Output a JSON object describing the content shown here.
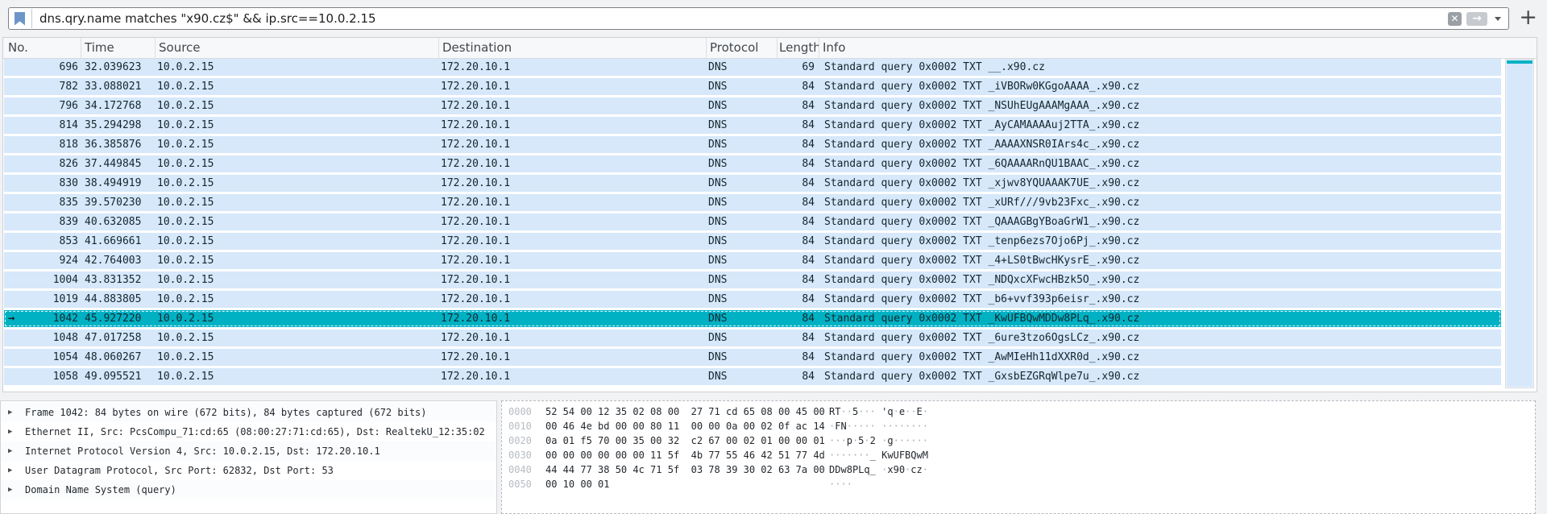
{
  "filter": {
    "expression": "dns.qry.name matches \"x90.cz$\" && ip.src==10.0.2.15",
    "add_button": "+"
  },
  "icons": {
    "clear": "✕",
    "apply": "→"
  },
  "colors": {
    "selected_row_bg": "#00b1c4",
    "row_bg": "#d6e8fa",
    "row_text": "#12272e"
  },
  "packet_list": {
    "columns": [
      "No.",
      "Time",
      "Source",
      "Destination",
      "Protocol",
      "Length",
      "Info"
    ],
    "rows": [
      {
        "no": "696",
        "time": "32.039623",
        "source": "10.0.2.15",
        "destination": "172.20.10.1",
        "protocol": "DNS",
        "length": "69",
        "info": "Standard query 0x0002 TXT __.x90.cz"
      },
      {
        "no": "782",
        "time": "33.088021",
        "source": "10.0.2.15",
        "destination": "172.20.10.1",
        "protocol": "DNS",
        "length": "84",
        "info": "Standard query 0x0002 TXT _iVBORw0KGgoAAAA_.x90.cz"
      },
      {
        "no": "796",
        "time": "34.172768",
        "source": "10.0.2.15",
        "destination": "172.20.10.1",
        "protocol": "DNS",
        "length": "84",
        "info": "Standard query 0x0002 TXT _NSUhEUgAAAMgAAA_.x90.cz"
      },
      {
        "no": "814",
        "time": "35.294298",
        "source": "10.0.2.15",
        "destination": "172.20.10.1",
        "protocol": "DNS",
        "length": "84",
        "info": "Standard query 0x0002 TXT _AyCAMAAAAuj2TTA_.x90.cz"
      },
      {
        "no": "818",
        "time": "36.385876",
        "source": "10.0.2.15",
        "destination": "172.20.10.1",
        "protocol": "DNS",
        "length": "84",
        "info": "Standard query 0x0002 TXT _AAAAXNSR0IArs4c_.x90.cz"
      },
      {
        "no": "826",
        "time": "37.449845",
        "source": "10.0.2.15",
        "destination": "172.20.10.1",
        "protocol": "DNS",
        "length": "84",
        "info": "Standard query 0x0002 TXT _6QAAAARnQU1BAAC_.x90.cz"
      },
      {
        "no": "830",
        "time": "38.494919",
        "source": "10.0.2.15",
        "destination": "172.20.10.1",
        "protocol": "DNS",
        "length": "84",
        "info": "Standard query 0x0002 TXT _xjwv8YQUAAAK7UE_.x90.cz"
      },
      {
        "no": "835",
        "time": "39.570230",
        "source": "10.0.2.15",
        "destination": "172.20.10.1",
        "protocol": "DNS",
        "length": "84",
        "info": "Standard query 0x0002 TXT _xURf///9vb23Fxc_.x90.cz"
      },
      {
        "no": "839",
        "time": "40.632085",
        "source": "10.0.2.15",
        "destination": "172.20.10.1",
        "protocol": "DNS",
        "length": "84",
        "info": "Standard query 0x0002 TXT _QAAAGBgYBoaGrW1_.x90.cz"
      },
      {
        "no": "853",
        "time": "41.669661",
        "source": "10.0.2.15",
        "destination": "172.20.10.1",
        "protocol": "DNS",
        "length": "84",
        "info": "Standard query 0x0002 TXT _tenp6ezs7Ojo6Pj_.x90.cz"
      },
      {
        "no": "924",
        "time": "42.764003",
        "source": "10.0.2.15",
        "destination": "172.20.10.1",
        "protocol": "DNS",
        "length": "84",
        "info": "Standard query 0x0002 TXT _4+LS0tBwcHKysrE_.x90.cz"
      },
      {
        "no": "1004",
        "time": "43.831352",
        "source": "10.0.2.15",
        "destination": "172.20.10.1",
        "protocol": "DNS",
        "length": "84",
        "info": "Standard query 0x0002 TXT _NDQxcXFwcHBzk5O_.x90.cz"
      },
      {
        "no": "1019",
        "time": "44.883805",
        "source": "10.0.2.15",
        "destination": "172.20.10.1",
        "protocol": "DNS",
        "length": "84",
        "info": "Standard query 0x0002 TXT _b6+vvf393p6eisr_.x90.cz"
      },
      {
        "no": "1042",
        "time": "45.927220",
        "source": "10.0.2.15",
        "destination": "172.20.10.1",
        "protocol": "DNS",
        "length": "84",
        "info": "Standard query 0x0002 TXT _KwUFBQwMDDw8PLq_.x90.cz",
        "selected": true
      },
      {
        "no": "1048",
        "time": "47.017258",
        "source": "10.0.2.15",
        "destination": "172.20.10.1",
        "protocol": "DNS",
        "length": "84",
        "info": "Standard query 0x0002 TXT _6ure3tzo6OgsLCz_.x90.cz"
      },
      {
        "no": "1054",
        "time": "48.060267",
        "source": "10.0.2.15",
        "destination": "172.20.10.1",
        "protocol": "DNS",
        "length": "84",
        "info": "Standard query 0x0002 TXT _AwMIeHh11dXXR0d_.x90.cz"
      },
      {
        "no": "1058",
        "time": "49.095521",
        "source": "10.0.2.15",
        "destination": "172.20.10.1",
        "protocol": "DNS",
        "length": "84",
        "info": "Standard query 0x0002 TXT _GxsbEZGRqWlpe7u_.x90.cz"
      }
    ]
  },
  "details": {
    "lines": [
      "Frame 1042: 84 bytes on wire (672 bits), 84 bytes captured (672 bits)",
      "Ethernet II, Src: PcsCompu_71:cd:65 (08:00:27:71:cd:65), Dst: RealtekU_12:35:02",
      "Internet Protocol Version 4, Src: 10.0.2.15, Dst: 172.20.10.1",
      "User Datagram Protocol, Src Port: 62832, Dst Port: 53",
      "Domain Name System (query)"
    ]
  },
  "hex_dump": {
    "rows": [
      {
        "offset": "0000",
        "hex1": "52 54 00 12 35 02 08 00",
        "hex2": "27 71 cd 65 08 00 45 00",
        "ascii1": "RT··5···",
        "ascii2": "'q·e··E·"
      },
      {
        "offset": "0010",
        "hex1": "00 46 4e bd 00 00 80 11",
        "hex2": "00 00 0a 00 02 0f ac 14",
        "ascii1": "·FN·····",
        "ascii2": "········"
      },
      {
        "offset": "0020",
        "hex1": "0a 01 f5 70 00 35 00 32",
        "hex2": "c2 67 00 02 01 00 00 01",
        "ascii1": "···p·5·2",
        "ascii2": "·g······"
      },
      {
        "offset": "0030",
        "hex1": "00 00 00 00 00 00 11 5f",
        "hex2": "4b 77 55 46 42 51 77 4d",
        "ascii1": "·······_",
        "ascii2": "KwUFBQwM"
      },
      {
        "offset": "0040",
        "hex1": "44 44 77 38 50 4c 71 5f",
        "hex2": "03 78 39 30 02 63 7a 00",
        "ascii1": "DDw8PLq_",
        "ascii2": "·x90·cz·"
      },
      {
        "offset": "0050",
        "hex1": "00 10 00 01",
        "hex2": "",
        "ascii1": "····",
        "ascii2": ""
      }
    ]
  }
}
